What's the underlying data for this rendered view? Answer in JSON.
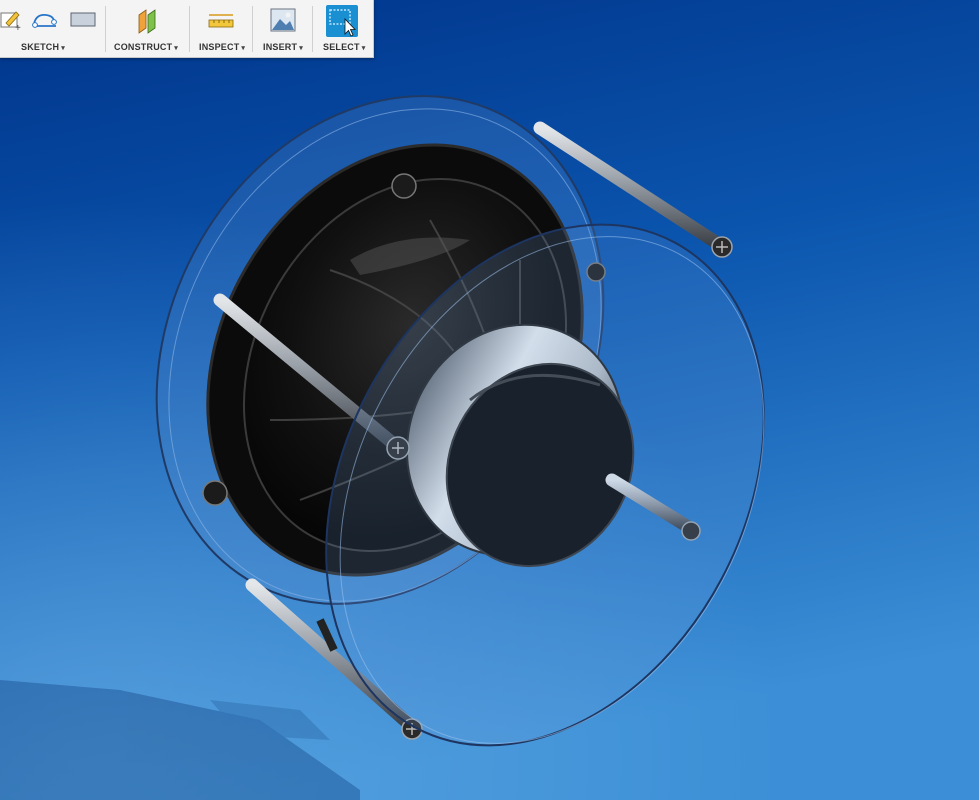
{
  "toolbar": {
    "groups": [
      {
        "label": "SKETCH",
        "caret": "▾"
      },
      {
        "label": "CONSTRUCT",
        "caret": "▾"
      },
      {
        "label": "INSPECT",
        "caret": "▾"
      },
      {
        "label": "INSERT",
        "caret": "▾"
      },
      {
        "label": "SELECT",
        "caret": "▾"
      }
    ],
    "icons": {
      "sketch": [
        "create-sketch-icon",
        "spline-icon",
        "rectangle-icon"
      ],
      "construct": "offset-plane-icon",
      "inspect": "measure-icon",
      "insert": "insert-image-icon",
      "select": "select-cursor-icon"
    },
    "select_active_color": "#1a8fd1"
  },
  "viewport": {
    "background_gradient": [
      "#003a8c",
      "#0a56b0",
      "#2b82cf"
    ],
    "model": "speaker-driver-assembly",
    "enclosure_material": "translucent-acrylic",
    "driver_color": "#0b0b0b",
    "rod_color": "#9aa0a8",
    "rod_count": 4
  }
}
